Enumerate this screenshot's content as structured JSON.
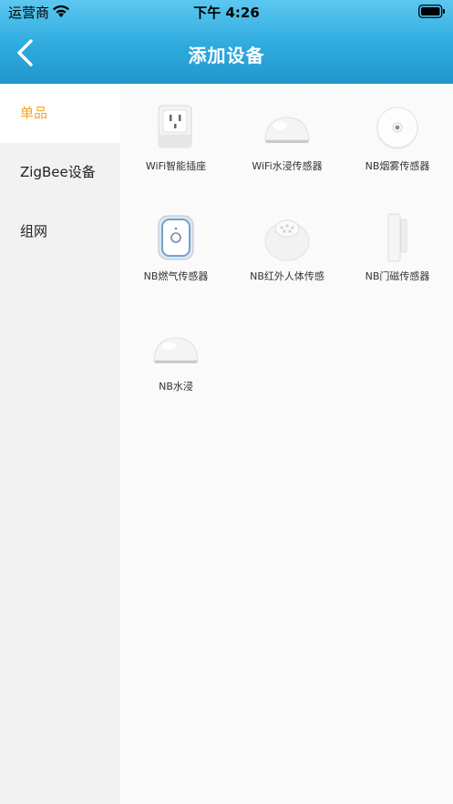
{
  "status_bar": {
    "carrier": "运营商",
    "time": "下午 4:26"
  },
  "nav": {
    "title": "添加设备",
    "back_icon": "chevron-left-icon"
  },
  "sidebar": {
    "items": [
      {
        "label": "单品",
        "active": true
      },
      {
        "label": "ZigBee设备",
        "active": false
      },
      {
        "label": "组网",
        "active": false
      }
    ]
  },
  "devices": [
    {
      "label": "WiFi智能插座",
      "icon": "smart-plug-icon"
    },
    {
      "label": "WiFi水浸传感器",
      "icon": "water-leak-sensor-icon"
    },
    {
      "label": "NB烟雾传感器",
      "icon": "smoke-sensor-icon"
    },
    {
      "label": "NB燃气传感器",
      "icon": "gas-sensor-icon"
    },
    {
      "label": "NB红外人体传感",
      "icon": "infrared-motion-sensor-icon"
    },
    {
      "label": "NB门磁传感器",
      "icon": "door-sensor-icon"
    },
    {
      "label": "NB水浸",
      "icon": "water-leak-sensor-icon"
    }
  ],
  "colors": {
    "header": "#2eaadf",
    "active_tab": "#f5a623"
  }
}
